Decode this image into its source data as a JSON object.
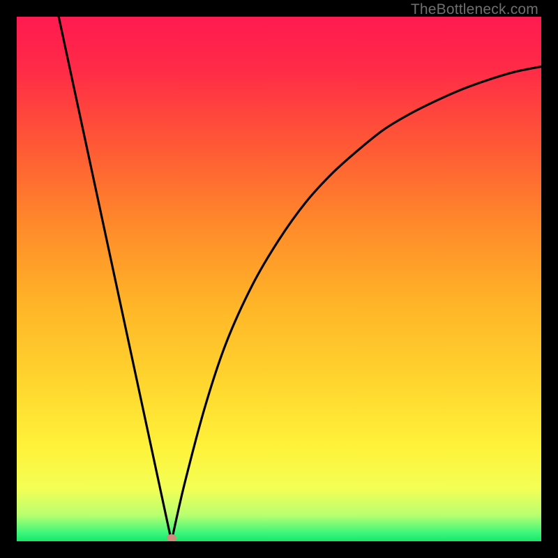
{
  "watermark": "TheBottleneck.com",
  "colors": {
    "gradient_stops": [
      {
        "pos": 0.0,
        "color": "#ff1a50"
      },
      {
        "pos": 0.1,
        "color": "#ff2b47"
      },
      {
        "pos": 0.25,
        "color": "#ff5a35"
      },
      {
        "pos": 0.4,
        "color": "#ff8b2a"
      },
      {
        "pos": 0.55,
        "color": "#ffb528"
      },
      {
        "pos": 0.7,
        "color": "#ffd62e"
      },
      {
        "pos": 0.82,
        "color": "#fff23a"
      },
      {
        "pos": 0.9,
        "color": "#f3ff55"
      },
      {
        "pos": 0.95,
        "color": "#b9ff70"
      },
      {
        "pos": 0.985,
        "color": "#39f67a"
      },
      {
        "pos": 1.0,
        "color": "#18e66b"
      }
    ],
    "curve": "#000000",
    "marker": "#cf8d7e",
    "frame": "#000000"
  },
  "chart_data": {
    "type": "line",
    "title": "",
    "xlabel": "",
    "ylabel": "",
    "xlim": [
      0,
      1
    ],
    "ylim": [
      0,
      1
    ],
    "x_min_point": 0.295,
    "left_branch": {
      "x": [
        0.08,
        0.295
      ],
      "y": [
        1.0,
        0.0
      ]
    },
    "right_branch_x": [
      0.295,
      0.32,
      0.36,
      0.4,
      0.45,
      0.5,
      0.55,
      0.6,
      0.65,
      0.7,
      0.75,
      0.8,
      0.85,
      0.9,
      0.95,
      1.0
    ],
    "right_branch_y": [
      0.0,
      0.11,
      0.26,
      0.38,
      0.49,
      0.575,
      0.645,
      0.7,
      0.745,
      0.785,
      0.815,
      0.84,
      0.862,
      0.88,
      0.895,
      0.905
    ],
    "marker": {
      "x": 0.295,
      "y": 0.007
    }
  }
}
